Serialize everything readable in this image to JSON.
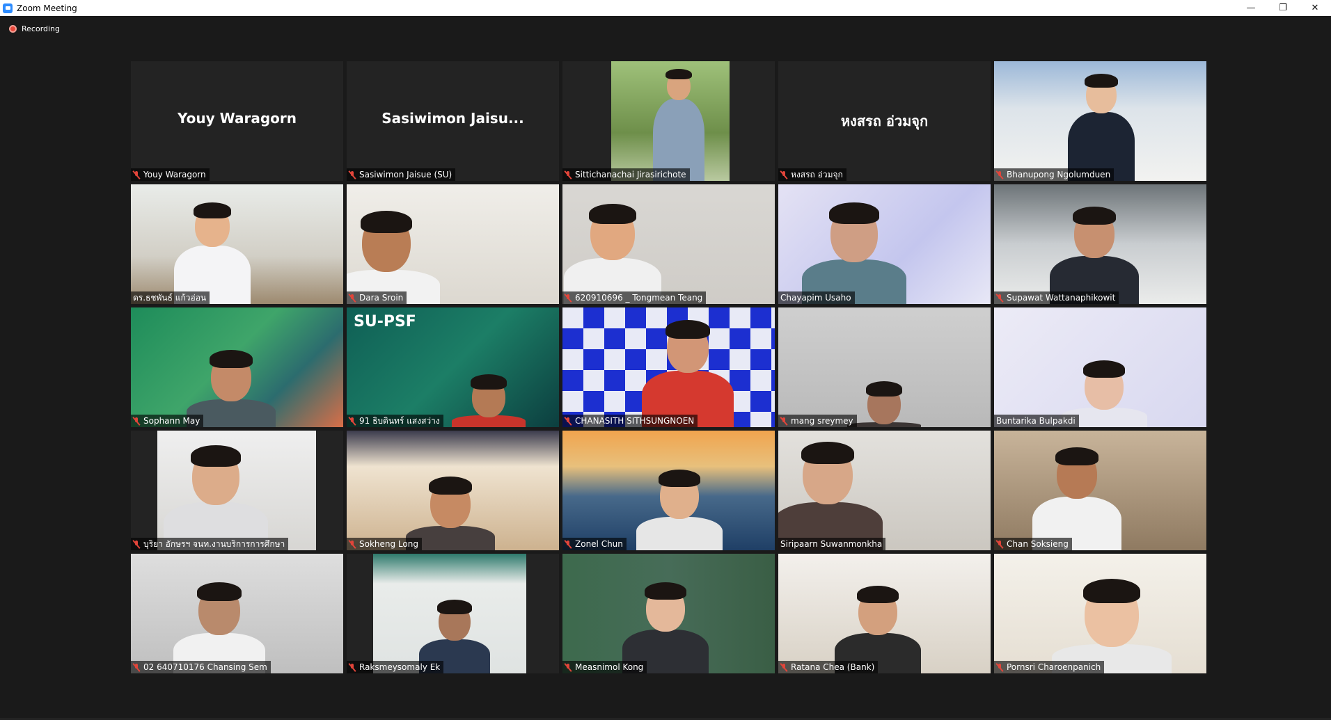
{
  "window": {
    "title": "Zoom Meeting",
    "minimize_glyph": "—",
    "restore_glyph": "❐",
    "close_glyph": "✕"
  },
  "recording": {
    "label": "Recording",
    "color": "#e8473a"
  },
  "active_speaker_color": "#e6f05a",
  "participants": [
    {
      "name": "Youy Waragorn",
      "display_name": "Youy Waragorn",
      "muted": true,
      "video": false
    },
    {
      "name": "Sasiwimon Jaisue (SU)",
      "display_name": "Sasiwimon  Jaisu...",
      "muted": true,
      "video": false
    },
    {
      "name": "Sittichanachai Jirasirichote",
      "muted": true,
      "video": true
    },
    {
      "name": "หงสรถ อ่วมจุก",
      "display_name": "หงสรถ อ่วมจุก",
      "muted": true,
      "video": false
    },
    {
      "name": "Bhanupong Ngolumduen",
      "muted": true,
      "video": true
    },
    {
      "name": "ดร.ธชพันธ์  แก้วอ่อน",
      "muted": false,
      "video": true
    },
    {
      "name": "Dara Sroin",
      "muted": true,
      "video": true
    },
    {
      "name": "620910696 _ Tongmean Teang",
      "muted": true,
      "video": true
    },
    {
      "name": "Chayapim Usaho",
      "muted": false,
      "video": true,
      "active": true
    },
    {
      "name": "Supawat Wattanaphikowit",
      "muted": true,
      "video": true
    },
    {
      "name": "Sophann May",
      "muted": true,
      "video": true
    },
    {
      "name": "91 ธิบดินทร์ แสงสว่าง",
      "muted": true,
      "video": true,
      "overlay": "SU-PSF"
    },
    {
      "name": "CHANASITH SITHSUNGNOEN",
      "muted": true,
      "video": true
    },
    {
      "name": "mang sreymey",
      "muted": true,
      "video": true
    },
    {
      "name": "Buntarika Bulpakdi",
      "muted": false,
      "video": true
    },
    {
      "name": "บุริยา อักษรฯ จนท.งานบริการการศึกษา",
      "muted": true,
      "video": true
    },
    {
      "name": "Sokheng Long",
      "muted": true,
      "video": true
    },
    {
      "name": "Zonel Chun",
      "muted": true,
      "video": true
    },
    {
      "name": "Siripaarn Suwanmonkha",
      "muted": false,
      "video": true
    },
    {
      "name": "Chan Soksieng",
      "muted": true,
      "video": true
    },
    {
      "name": "02 640710176 Chansing Sem",
      "muted": true,
      "video": true
    },
    {
      "name": "Raksmeysomaly Ek",
      "muted": true,
      "video": true
    },
    {
      "name": "Measnimol Kong",
      "muted": true,
      "video": true
    },
    {
      "name": "Ratana Chea (Bank)",
      "muted": true,
      "video": true
    },
    {
      "name": "Pornsri Charoenpanich",
      "muted": true,
      "video": true
    }
  ]
}
